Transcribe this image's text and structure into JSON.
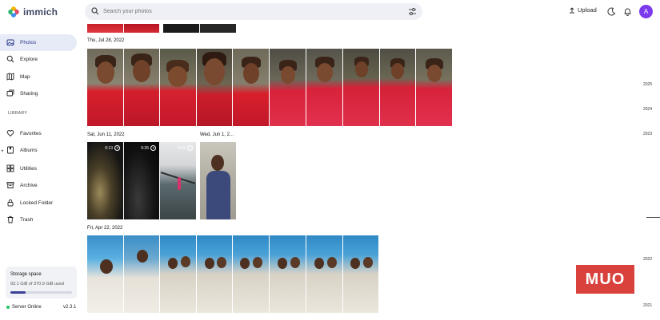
{
  "header": {
    "app_name": "immich",
    "search_placeholder": "Search your photos",
    "upload_label": "Upload",
    "avatar_initial": "A"
  },
  "sidebar": {
    "items": [
      {
        "label": "Photos",
        "icon": "photos-icon",
        "active": true
      },
      {
        "label": "Explore",
        "icon": "explore-icon"
      },
      {
        "label": "Map",
        "icon": "map-icon"
      },
      {
        "label": "Sharing",
        "icon": "sharing-icon"
      }
    ],
    "library_title": "LIBRARY",
    "library_items": [
      {
        "label": "Favorites",
        "icon": "heart-icon"
      },
      {
        "label": "Albums",
        "icon": "albums-icon"
      },
      {
        "label": "Utilities",
        "icon": "utilities-icon"
      },
      {
        "label": "Archive",
        "icon": "archive-icon"
      },
      {
        "label": "Locked Folder",
        "icon": "lock-icon"
      },
      {
        "label": "Trash",
        "icon": "trash-icon"
      }
    ],
    "storage": {
      "title": "Storage space",
      "usage": "93.1 GiB of 370.9 GiB used",
      "fraction": 0.251
    },
    "server_status": "Server Online",
    "version": "v2.3.1"
  },
  "timeline": {
    "groups": [
      {
        "date": "Thu, Jul 28, 2022"
      },
      {
        "date": "Sat, Jun 11, 2022"
      },
      {
        "date": "Wed, Jun 1, 2..."
      },
      {
        "date": "Fri, Apr 22, 2022"
      }
    ],
    "durations": [
      "0:13",
      "0:35",
      "0:34"
    ]
  },
  "scrubber": {
    "years": [
      "2025",
      "2024",
      "2023",
      "2022",
      "2021"
    ]
  },
  "watermark": "MUO",
  "colors": {
    "accent": "#3a3f96",
    "active_bg": "#e6ebf7",
    "online": "#22c55e",
    "avatar": "#7c3aed"
  }
}
